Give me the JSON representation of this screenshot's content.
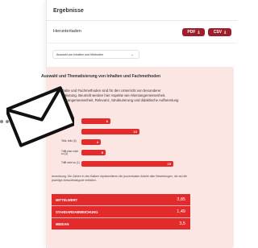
{
  "card": {
    "title": "Ergebnisse",
    "download_label": "Herunterladen",
    "pdf_button": "PDF",
    "csv_button": "CSV",
    "download_icon": "download-icon"
  },
  "select": {
    "value": "Auswahl von Inhalten und Methoden"
  },
  "panel": {
    "title": "Auswahl und Thematisierung von Inhalten und Fachmethoden",
    "desc_lines": [
      "Inhalte und Fachmethoden sind für den Unterricht von besonderer",
      "Bedeutung. Beurteilt werden hier Aspekte wie Altersangemessenheit,",
      "Sachangemessenheit, Relevanz, Strukturierung und didaktische Aufbereitung"
    ]
  },
  "chart_data": {
    "type": "bar",
    "categories": [
      "",
      "",
      "Teils, teils (3)",
      "Trifft eher nicht zu (2)",
      "Trifft nicht zu (1)"
    ],
    "values": [
      6,
      12,
      4,
      5,
      19
    ],
    "max": 20
  },
  "note": "Anmerkung: Die Zahlen in den Balken repräsentieren die prozentualen Anteile aller Bewertungen, die auf die jeweilige Antwortkategorie entfallen.",
  "stats": [
    {
      "label": "MITTELWERT",
      "value": "3,85"
    },
    {
      "label": "STANDARDABWEICHUNG",
      "value": "1,49"
    },
    {
      "label": "MEDIAN",
      "value": "3,5"
    }
  ],
  "colors": {
    "accent": "#e32b2b",
    "button": "#9c1e2b",
    "panel": "#fbe6e4"
  },
  "overlay_icon": "envelope-icon"
}
